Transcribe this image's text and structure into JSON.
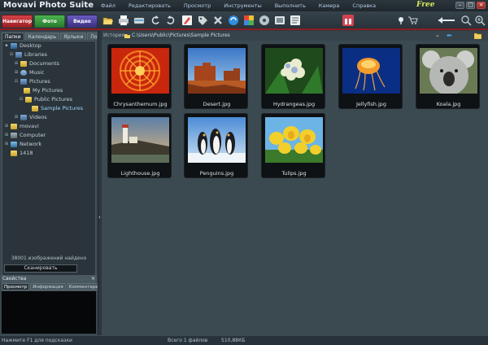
{
  "app": {
    "title": "Movavi Photo Suite",
    "badge": "Free"
  },
  "menu": [
    "Файл",
    "Редактировать",
    "Просмотр",
    "Инструменты",
    "Выполнить",
    "Камера",
    "Справка"
  ],
  "modes": {
    "navigator": "Навигатор",
    "photo": "Фото",
    "video": "Видео"
  },
  "toolbar_icons": [
    "open-icon",
    "print-icon",
    "scan-icon",
    "rotate-left-icon",
    "rotate-right-icon",
    "edit-icon",
    "tag-icon",
    "delete-icon",
    "refresh-icon",
    "slideshow-icon",
    "burn-icon",
    "compare-icon",
    "share-icon",
    "star-icon",
    "cart-icon",
    "back-icon",
    "zoom-out-icon",
    "zoom-in-icon"
  ],
  "left_tabs": [
    "Папки",
    "Календарь",
    "Ярлыки",
    "Поиск"
  ],
  "tree": {
    "desktop": "Desktop",
    "libraries": "Libraries",
    "documents": "Documents",
    "music": "Music",
    "pictures": "Pictures",
    "my_pictures": "My Pictures",
    "public_pictures": "Public Pictures",
    "sample_pictures": "Sample Pictures",
    "videos": "Videos",
    "movavi": "movavi",
    "computer": "Computer",
    "network": "Network",
    "folder_1418": "1418"
  },
  "found_text": "38001 изображений найдено",
  "scan_button": "Сканировать",
  "properties": {
    "title": "Свойства",
    "close": "×",
    "tabs": [
      "Просмотр",
      "Информация",
      "Комментарии"
    ]
  },
  "address": {
    "history_label": "История",
    "path": "C:\\Users\\Public\\Pictures\\Sample Pictures"
  },
  "thumbnails": [
    {
      "name": "Chrysanthemum.jpg",
      "scene": "chrysanthemum"
    },
    {
      "name": "Desert.jpg",
      "scene": "desert"
    },
    {
      "name": "Hydrangeas.jpg",
      "scene": "hydrangeas"
    },
    {
      "name": "Jellyfish.jpg",
      "scene": "jellyfish"
    },
    {
      "name": "Koala.jpg",
      "scene": "koala"
    },
    {
      "name": "Lighthouse.jpg",
      "scene": "lighthouse"
    },
    {
      "name": "Penguins.jpg",
      "scene": "penguins"
    },
    {
      "name": "Tulips.jpg",
      "scene": "tulips"
    }
  ],
  "status": {
    "hint": "Нажмите F1 для подсказки",
    "count": "Всего 1 файлов",
    "size": "510,88КБ"
  },
  "colors": {
    "accent_red": "#8e1c22",
    "menu_text": "#b4c7e6",
    "free_badge": "#d8ec5c"
  }
}
